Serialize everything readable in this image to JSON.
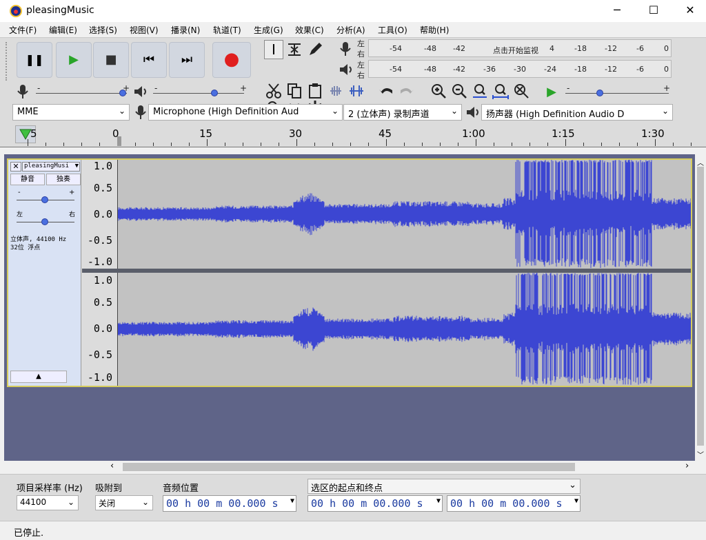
{
  "window": {
    "title": "pleasingMusic",
    "minimize": "─",
    "maximize": "☐",
    "close": "✕"
  },
  "menu": [
    "文件(F)",
    "编辑(E)",
    "选择(S)",
    "视图(V)",
    "播录(N)",
    "轨道(T)",
    "生成(G)",
    "效果(C)",
    "分析(A)",
    "工具(O)",
    "帮助(H)"
  ],
  "transport": {
    "pause": "❚❚",
    "play": "▶",
    "stop": "■",
    "skip_start": "⏮",
    "skip_end": "⏭",
    "record": "●"
  },
  "meters": {
    "record_lr": [
      "左",
      "右"
    ],
    "play_lr": [
      "左",
      "右"
    ],
    "record_scale": [
      "-54",
      "-48",
      "-42",
      "点击开始监视",
      "4",
      "-18",
      "-12",
      "-6",
      "0"
    ],
    "play_scale": [
      "-54",
      "-48",
      "-42",
      "-36",
      "-30",
      "-24",
      "-18",
      "-12",
      "-6",
      "0"
    ]
  },
  "mixer": {
    "minus": "-",
    "plus": "+"
  },
  "devices": {
    "host": "MME",
    "mic": "Microphone (High Definition Aud",
    "channels": "2 (立体声) 录制声道",
    "speaker": "扬声器 (High Definition Audio D"
  },
  "ruler": {
    "labels": [
      "5",
      "0",
      "15",
      "30",
      "45",
      "1:00",
      "1:15",
      "1:30"
    ]
  },
  "track": {
    "name": "pleasingMusi",
    "mute": "静音",
    "solo": "独奏",
    "gain_minus": "-",
    "gain_plus": "+",
    "pan_left": "左",
    "pan_right": "右",
    "info_line1": "立体声, 44100 Hz",
    "info_line2": "32位 浮点",
    "scale": [
      "1.0",
      "0.5",
      "0.0",
      "-0.5",
      "-1.0"
    ],
    "collapse": "▲"
  },
  "selection_bar": {
    "rate_label": "项目采样率 (Hz)",
    "rate_value": "44100",
    "snap_label": "吸附到",
    "snap_value": "关闭",
    "pos_label": "音频位置",
    "pos_value": "00 h 00 m 00.000 s",
    "range_label": "选区的起点和终点",
    "start_value": "00 h 00 m 00.000 s",
    "end_value": "00 h 00 m 00.000 s"
  },
  "status": "已停止.",
  "colors": {
    "waveform": "#3c46d2",
    "track_border": "#d6cc5c",
    "record_red": "#e01f1f",
    "play_green": "#2aa52a"
  }
}
